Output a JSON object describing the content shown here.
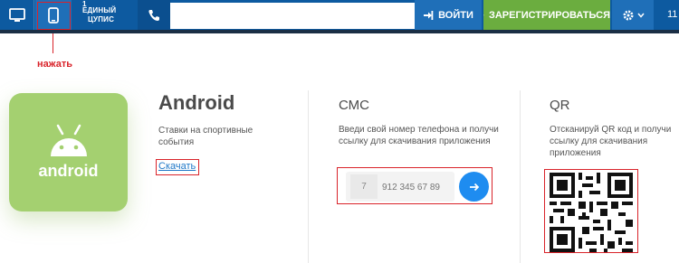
{
  "topbar": {
    "logo_line1": "ЕДИНЫЙ",
    "logo_line2": "ЦУПИС",
    "logo_sup": "1",
    "login_label": "ВОЙТИ",
    "register_label": "ЗАРЕГИСТРИРОВАТЬСЯ",
    "overflow_text": "11",
    "icons": {
      "monitor": "monitor-icon",
      "mobile": "mobile-phone-icon",
      "phone": "phone-icon",
      "login": "login-icon",
      "register": "edit-icon",
      "settings": "gear-icon",
      "chevron": "chevron-down-icon"
    }
  },
  "annotation": {
    "hint_text": "нажать",
    "color": "#d9232a"
  },
  "android": {
    "tile_label": "android",
    "title": "Android",
    "description": "Ставки на спортивные события",
    "download_link": "Скачать"
  },
  "sms": {
    "title": "СМС",
    "description": "Введи свой номер телефона и получи ссылку для скачивания приложения",
    "country_code": "7",
    "phone_placeholder": "912 345 67 89"
  },
  "qr": {
    "title": "QR",
    "description": "Отсканируй QR код и получи ссылку для скачивания приложения"
  },
  "colors": {
    "topbar": "#0d5aa0",
    "register": "#6bad3f",
    "android_tile": "#a4d070",
    "send_button": "#1e8cf0"
  }
}
